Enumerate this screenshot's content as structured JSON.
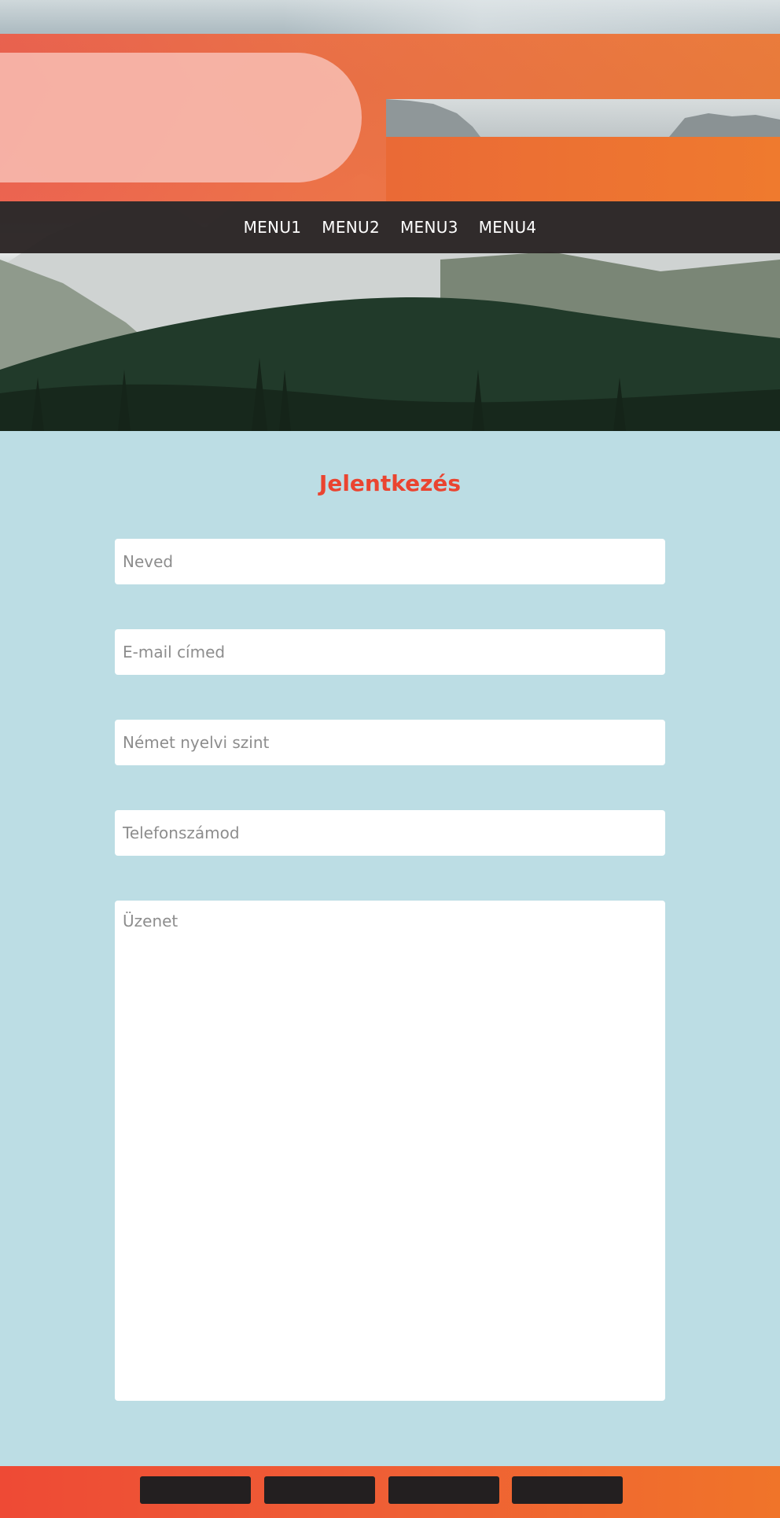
{
  "nav": {
    "items": [
      {
        "label": "MENU1"
      },
      {
        "label": "MENU2"
      },
      {
        "label": "MENU3"
      },
      {
        "label": "MENU4"
      }
    ]
  },
  "form": {
    "title": "Jelentkezés",
    "name_placeholder": "Neved",
    "email_placeholder": "E-mail címed",
    "german_level_placeholder": "Német nyelvi szint",
    "phone_placeholder": "Telefonszámod",
    "message_placeholder": "Üzenet"
  },
  "colors": {
    "accent": "#ea4430",
    "form_background": "#bcdde4",
    "navbar": "#262020",
    "band_orange_start": "#ee5a45",
    "band_orange_end": "#ef7630",
    "footer_button": "#231f20"
  }
}
